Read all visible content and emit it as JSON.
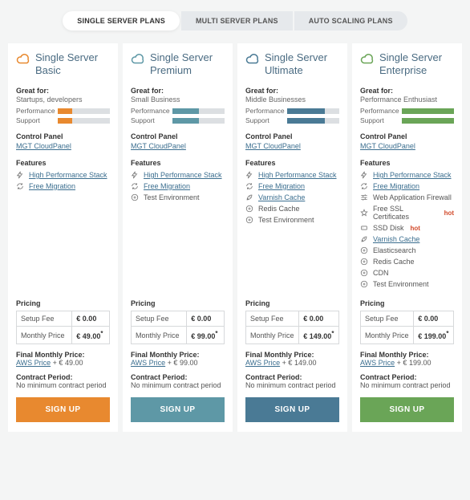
{
  "tabs": [
    "SINGLE SERVER PLANS",
    "MULTI SERVER PLANS",
    "AUTO SCALING PLANS"
  ],
  "active_tab": 0,
  "labels": {
    "great_for": "Great for:",
    "performance": "Performance",
    "support": "Support",
    "control_panel": "Control Panel",
    "cp_link": "MGT CloudPanel",
    "features": "Features",
    "pricing": "Pricing",
    "setup_fee": "Setup Fee",
    "monthly_price": "Monthly Price",
    "final_price": "Final Monthly Price:",
    "aws_price": "AWS Price",
    "contract": "Contract Period:",
    "contract_val": "No minimum contract period",
    "signup": "SIGN UP",
    "hot": "hot"
  },
  "plans": [
    {
      "name": "Single Server Basic",
      "color": "#e8892f",
      "audience": "Startups, developers",
      "perf": 28,
      "supp": 28,
      "features": [
        {
          "icon": "bolt",
          "text": "High Performance Stack",
          "link": true
        },
        {
          "icon": "cycle",
          "text": "Free Migration",
          "link": true
        }
      ],
      "setup": "€ 0.00",
      "monthly": "€ 49.00",
      "final": "49.00"
    },
    {
      "name": "Single Server Premium",
      "color": "#5e98a6",
      "audience": "Small Business",
      "perf": 50,
      "supp": 50,
      "features": [
        {
          "icon": "bolt",
          "text": "High Performance Stack",
          "link": true
        },
        {
          "icon": "cycle",
          "text": "Free Migration",
          "link": true
        },
        {
          "icon": "plus",
          "text": "Test Environment"
        }
      ],
      "setup": "€ 0.00",
      "monthly": "€ 99.00",
      "final": "99.00"
    },
    {
      "name": "Single Server Ultimate",
      "color": "#4a7a95",
      "audience": "Middle Businesses",
      "perf": 72,
      "supp": 72,
      "features": [
        {
          "icon": "bolt",
          "text": "High Performance Stack",
          "link": true
        },
        {
          "icon": "cycle",
          "text": "Free Migration",
          "link": true
        },
        {
          "icon": "rocket",
          "text": "Varnish Cache",
          "link": true
        },
        {
          "icon": "plus",
          "text": "Redis Cache"
        },
        {
          "icon": "plus",
          "text": "Test Environment"
        }
      ],
      "setup": "€ 0.00",
      "monthly": "€ 149.00",
      "final": "149.00"
    },
    {
      "name": "Single Server Enterprise",
      "color": "#6aa557",
      "audience": "Performance Enthusiast",
      "perf": 100,
      "supp": 100,
      "features": [
        {
          "icon": "bolt",
          "text": "High Performance Stack",
          "link": true
        },
        {
          "icon": "cycle",
          "text": "Free Migration",
          "link": true
        },
        {
          "icon": "wall",
          "text": "Web Application Firewall"
        },
        {
          "icon": "star",
          "text": "Free SSL Certificates",
          "hot": true
        },
        {
          "icon": "disk",
          "text": "SSD Disk",
          "hot": true
        },
        {
          "icon": "rocket",
          "text": "Varnish Cache",
          "link": true
        },
        {
          "icon": "plus",
          "text": "Elasticsearch"
        },
        {
          "icon": "plus",
          "text": "Redis Cache"
        },
        {
          "icon": "plus",
          "text": "CDN"
        },
        {
          "icon": "plus",
          "text": "Test Environment"
        }
      ],
      "setup": "€ 0.00",
      "monthly": "€ 199.00",
      "final": "199.00"
    }
  ]
}
